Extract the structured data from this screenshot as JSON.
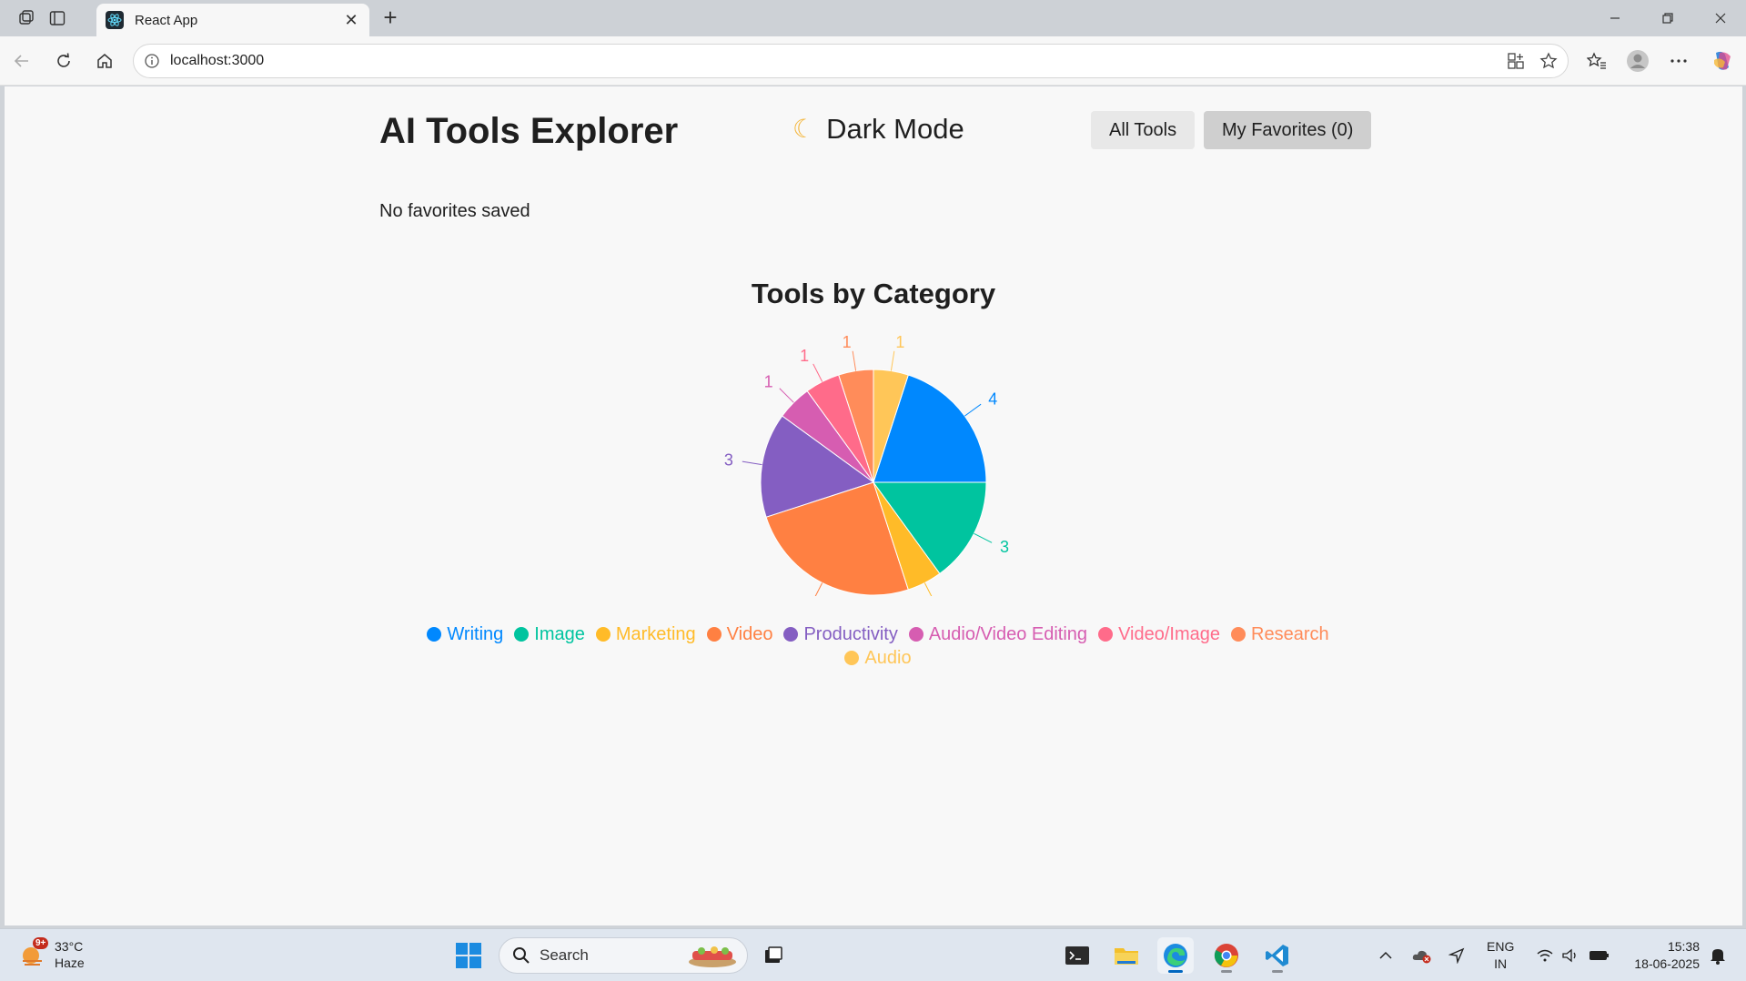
{
  "browser": {
    "tab_title": "React App",
    "url": "localhost:3000"
  },
  "app": {
    "title": "AI Tools Explorer",
    "theme_toggle_label": "Dark Mode",
    "theme_toggle_icon": "moon-icon",
    "all_tools_label": "All Tools",
    "favorites_label": "My Favorites (0)",
    "empty_favorites": "No favorites saved"
  },
  "chart_data": {
    "type": "pie",
    "title": "Tools by Category",
    "categories": [
      "Writing",
      "Audio",
      "Research",
      "Video/Image",
      "Audio/Video Editing",
      "Productivity",
      "Video",
      "Marketing",
      "Image"
    ],
    "values": [
      4,
      1,
      1,
      1,
      1,
      3,
      5,
      1,
      3
    ],
    "colors": [
      "#0088fe",
      "#ffc658",
      "#ff8c5a",
      "#ff6b8a",
      "#d65db1",
      "#845ec2",
      "#ff8042",
      "#ffbb28",
      "#00c49f"
    ],
    "legend": [
      "Writing",
      "Image",
      "Marketing",
      "Video",
      "Productivity",
      "Audio/Video Editing",
      "Video/Image",
      "Research",
      "Audio"
    ],
    "legend_colors": [
      "#0088fe",
      "#00c49f",
      "#ffbb28",
      "#ff8042",
      "#845ec2",
      "#d65db1",
      "#ff6b8a",
      "#ff8c5a",
      "#ffc658"
    ],
    "legend_position": "bottom"
  },
  "taskbar": {
    "temperature": "33°C",
    "condition": "Haze",
    "weather_badge": "9+",
    "search_label": "Search",
    "lang_top": "ENG",
    "lang_bottom": "IN",
    "time": "15:38",
    "date": "18-06-2025"
  }
}
